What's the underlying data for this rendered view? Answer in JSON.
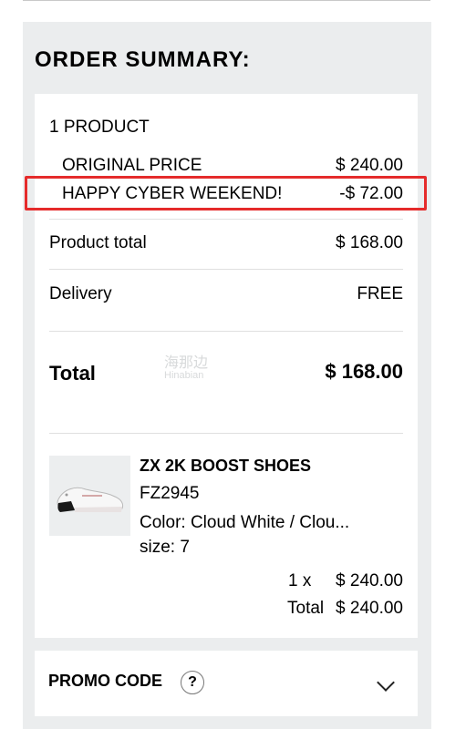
{
  "summary": {
    "title": "ORDER SUMMARY:",
    "product_count": "1 PRODUCT",
    "original_price_label": "ORIGINAL PRICE",
    "original_price_value": "$ 240.00",
    "discount_label": "HAPPY CYBER WEEKEND!",
    "discount_value": "-$ 72.00",
    "product_total_label": "Product total",
    "product_total_value": "$ 168.00",
    "delivery_label": "Delivery",
    "delivery_value": "FREE",
    "total_label": "Total",
    "total_value": "$ 168.00"
  },
  "watermark": {
    "cn": "海那边",
    "en": "Hinabian"
  },
  "product": {
    "name": "ZX 2K BOOST SHOES",
    "sku": "FZ2945",
    "color": "Color: Cloud White / Clou...",
    "size": "size: 7",
    "qty": "1 x",
    "unit_price": "$ 240.00",
    "total_label": "Total",
    "total_value": "$ 240.00"
  },
  "promo": {
    "label": "PROMO CODE",
    "help": "?"
  },
  "colors": {
    "panel": "#ebedee",
    "highlight": "#e52b2b"
  }
}
